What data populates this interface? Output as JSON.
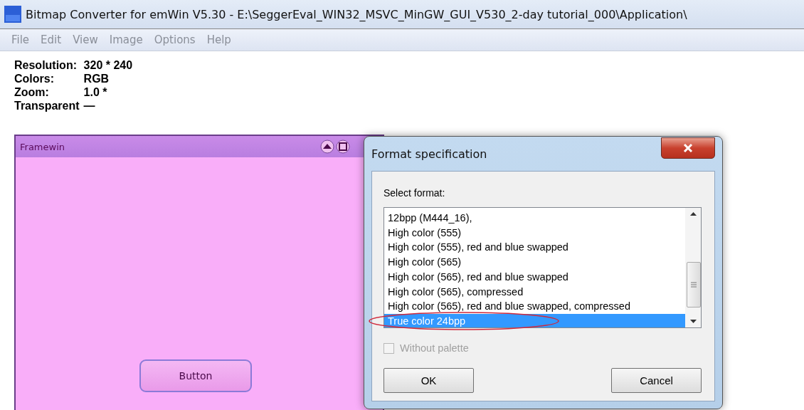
{
  "window": {
    "title": "Bitmap Converter for emWin V5.30 - E:\\SeggerEval_WIN32_MSVC_MinGW_GUI_V530_2-day tutorial_000\\Application\\"
  },
  "menu": [
    "File",
    "Edit",
    "View",
    "Image",
    "Options",
    "Help"
  ],
  "info": [
    {
      "label": "Resolution:",
      "value": "320 * 240"
    },
    {
      "label": "Colors:",
      "value": "RGB"
    },
    {
      "label": "Zoom:",
      "value": "1.0 *"
    },
    {
      "label": "Transparent",
      "value": "—"
    }
  ],
  "framewin": {
    "title": "Framewin",
    "button": "Button"
  },
  "dialog": {
    "title": "Format specification",
    "prompt": "Select format:",
    "formats": [
      {
        "label": "12bpp (M444_16),",
        "selected": false
      },
      {
        "label": "High color (555)",
        "selected": false
      },
      {
        "label": "High color (555), red and blue swapped",
        "selected": false
      },
      {
        "label": "High color (565)",
        "selected": false
      },
      {
        "label": "High color (565), red and blue swapped",
        "selected": false
      },
      {
        "label": "High color (565), compressed",
        "selected": false
      },
      {
        "label": "High color (565), red and blue swapped, compressed",
        "selected": false
      },
      {
        "label": "True color 24bpp",
        "selected": true
      }
    ],
    "checkbox": {
      "label": "Without palette",
      "checked": false,
      "disabled": true
    },
    "buttons": [
      "OK",
      "Cancel"
    ]
  }
}
